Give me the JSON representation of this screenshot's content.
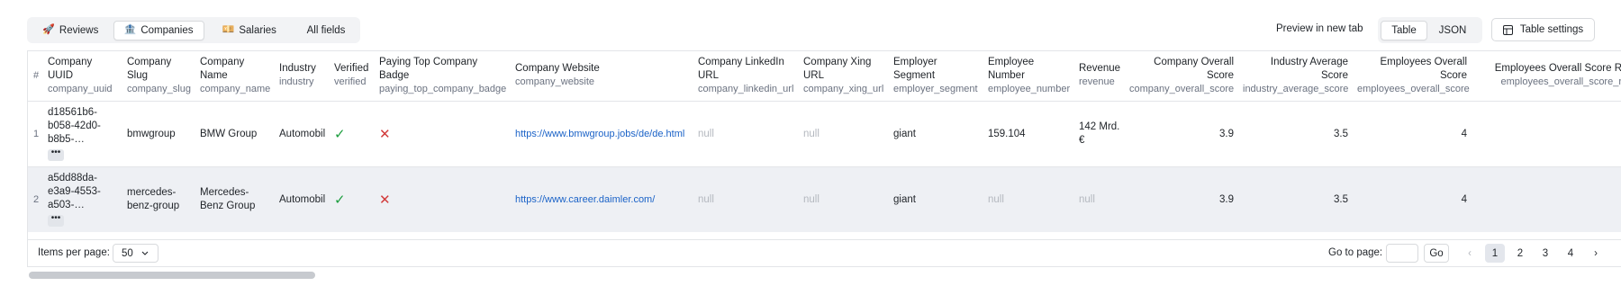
{
  "view_tabs": [
    {
      "icon": "🚀",
      "label": "Reviews"
    },
    {
      "icon": "🏦",
      "label": "Companies"
    },
    {
      "icon": "💴",
      "label": "Salaries"
    },
    {
      "icon": "",
      "label": "All fields"
    }
  ],
  "active_view_tab": "Companies",
  "preview_label": "Preview in new tab",
  "format_tabs": [
    "Table",
    "JSON"
  ],
  "active_format_tab": "Table",
  "settings_label": "Table settings",
  "table": {
    "index_header": "#",
    "columns": [
      {
        "title": "Company UUID",
        "key": "company_uuid"
      },
      {
        "title": "Company Slug",
        "key": "company_slug"
      },
      {
        "title": "Company Name",
        "key": "company_name"
      },
      {
        "title": "Industry",
        "key": "industry"
      },
      {
        "title": "Verified",
        "key": "verified"
      },
      {
        "title": "Paying Top Company Badge",
        "key": "paying_top_company_badge"
      },
      {
        "title": "Company Website",
        "key": "company_website"
      },
      {
        "title": "Company LinkedIn URL",
        "key": "company_linkedin_url"
      },
      {
        "title": "Company Xing URL",
        "key": "company_xing_url"
      },
      {
        "title": "Employer Segment",
        "key": "employer_segment"
      },
      {
        "title": "Employee Number",
        "key": "employee_number"
      },
      {
        "title": "Revenue",
        "key": "revenue"
      },
      {
        "title": "Company Overall Score",
        "key": "company_overall_score"
      },
      {
        "title": "Industry Average Score",
        "key": "industry_average_score"
      },
      {
        "title": "Employees Overall Score",
        "key": "employees_overall_score"
      },
      {
        "title": "Employees Overall Score R",
        "key": "employees_overall_score_r"
      }
    ],
    "rows": [
      {
        "index": "1",
        "uuid": "d18561b6-b058-42d0-b8b5-…",
        "slug": "bmwgroup",
        "name": "BMW Group",
        "industry": "Automobil",
        "verified": "✓",
        "badge": "✕",
        "website": "https://www.bmwgroup.jobs/de/de.html",
        "linkedin": "null",
        "xing": "null",
        "segment": "giant",
        "employees": "159.104",
        "revenue": "142 Mrd. €",
        "overall": "3.9",
        "industry_avg": "3.5",
        "employees_overall": "4"
      },
      {
        "index": "2",
        "uuid": "a5dd88da-e3a9-4553-a503-…",
        "slug": "mercedes-benz-group",
        "name": "Mercedes-Benz Group",
        "industry": "Automobil",
        "verified": "✓",
        "badge": "✕",
        "website": "https://www.career.daimler.com/",
        "linkedin": "null",
        "xing": "null",
        "segment": "giant",
        "employees": "null",
        "revenue": "null",
        "overall": "3.9",
        "industry_avg": "3.5",
        "employees_overall": "4"
      }
    ],
    "more_glyph": "•••"
  },
  "footer": {
    "items_per_page_label": "Items per page:",
    "items_per_page_value": "50",
    "goto_label": "Go to page:",
    "go_label": "Go",
    "prev_glyph": "‹",
    "next_glyph": "›",
    "pages": [
      "1",
      "2",
      "3",
      "4"
    ],
    "current_page": "1"
  },
  "colors": {
    "link": "#1a62c7",
    "check": "#1d9e3f",
    "cross": "#d23b3b",
    "null": "#b4b8bf"
  }
}
